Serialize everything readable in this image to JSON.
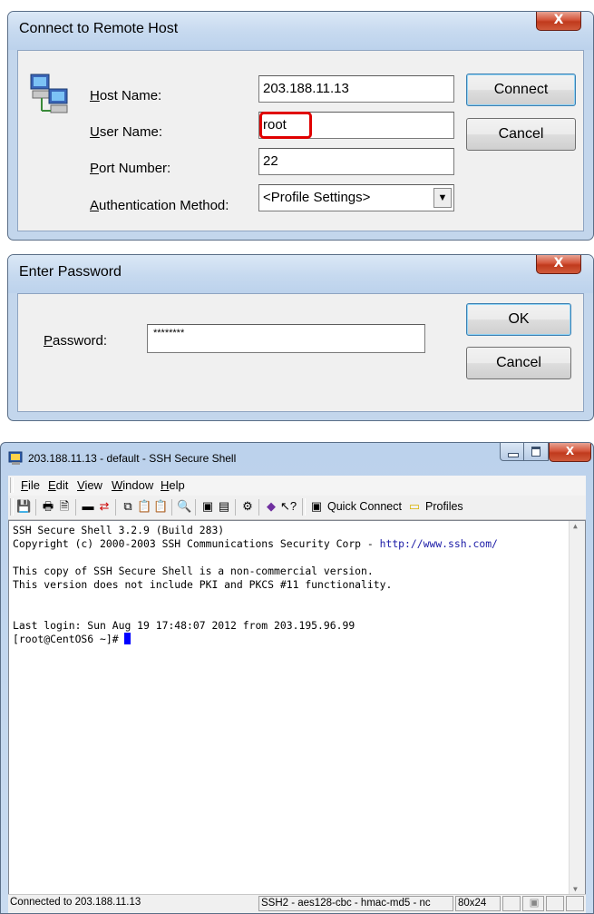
{
  "connect_dialog": {
    "title": "Connect to Remote Host",
    "close_glyph": "X",
    "host_label_ul": "H",
    "host_label_rest": "ost Name:",
    "host_value": "203.188.11.13",
    "user_label_ul": "U",
    "user_label_rest": "ser Name:",
    "user_value": "root",
    "port_label_ul": "P",
    "port_label_rest": "ort Number:",
    "port_value": "22",
    "auth_label_ul": "A",
    "auth_label_rest": "uthentication Method:",
    "auth_value": "<Profile Settings>",
    "connect_button": "Connect",
    "cancel_button": "Cancel",
    "highlight_color": "#e00000"
  },
  "password_dialog": {
    "title": "Enter Password",
    "close_glyph": "X",
    "password_label_ul": "P",
    "password_label_rest": "assword:",
    "password_value": "********",
    "ok_button": "OK",
    "cancel_button": "Cancel"
  },
  "ssh_window": {
    "title": "203.188.11.13 - default - SSH Secure Shell",
    "menu": [
      {
        "ul": "F",
        "rest": "ile"
      },
      {
        "ul": "E",
        "rest": "dit"
      },
      {
        "ul": "V",
        "rest": "iew"
      },
      {
        "ul": "W",
        "rest": "indow"
      },
      {
        "ul": "H",
        "rest": "elp"
      }
    ],
    "toolbar": {
      "quick_connect": "Quick Connect",
      "profiles": "Profiles"
    },
    "terminal_lines": [
      "SSH Secure Shell 3.2.9 (Build 283)",
      "Copyright (c) 2000-2003 SSH Communications Security Corp - ",
      "",
      "This copy of SSH Secure Shell is a non-commercial version.",
      "This version does not include PKI and PKCS #11 functionality.",
      "",
      "",
      "Last login: Sun Aug 19 17:48:07 2012 from 203.195.96.99",
      "[root@CentOS6 ~]# "
    ],
    "copyright_link": "http://www.ssh.com/",
    "link_color": "#1a1aa6",
    "cursor_color": "#0000ff",
    "status": {
      "connection": "Connected to 203.188.11.13",
      "cipher": "SSH2 - aes128-cbc - hmac-md5 - nc",
      "size": "80x24"
    }
  }
}
